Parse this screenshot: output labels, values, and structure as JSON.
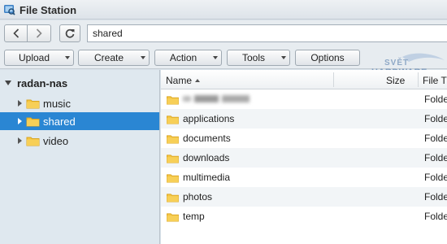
{
  "app": {
    "title": "File Station"
  },
  "nav": {
    "path": "shared"
  },
  "toolbar": {
    "upload": "Upload",
    "create": "Create",
    "action": "Action",
    "tools": "Tools",
    "options": "Options"
  },
  "watermark": {
    "line1": "SVĚT",
    "line2": "HARDWARE"
  },
  "tree": {
    "root": "radan-nas",
    "items": [
      {
        "label": "music",
        "selected": false
      },
      {
        "label": "shared",
        "selected": true
      },
      {
        "label": "video",
        "selected": false
      }
    ]
  },
  "filelist": {
    "columns": {
      "name": "Name",
      "size": "Size",
      "type": "File T"
    },
    "rows": [
      {
        "name": "",
        "type": "Folde",
        "redacted": true
      },
      {
        "name": "applications",
        "type": "Folde"
      },
      {
        "name": "documents",
        "type": "Folde"
      },
      {
        "name": "downloads",
        "type": "Folde"
      },
      {
        "name": "multimedia",
        "type": "Folde"
      },
      {
        "name": "photos",
        "type": "Folde"
      },
      {
        "name": "temp",
        "type": "Folde"
      }
    ]
  },
  "colors": {
    "selection": "#2a86d3",
    "folder": "#f5c542",
    "sidebar": "#dfe8ef"
  },
  "icons": {
    "app": "file-station-icon",
    "back": "chevron-left-icon",
    "forward": "chevron-right-icon",
    "refresh": "refresh-icon",
    "folder": "folder-icon"
  }
}
